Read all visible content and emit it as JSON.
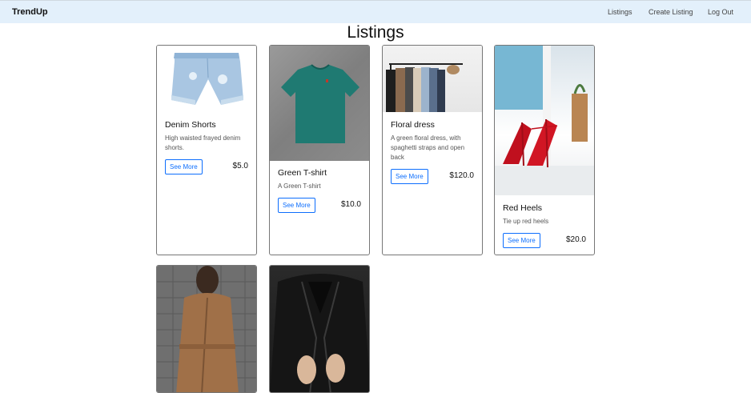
{
  "nav": {
    "brand": "TrendUp",
    "links": [
      "Listings",
      "Create Listing",
      "Log Out"
    ]
  },
  "page": {
    "title": "Listings"
  },
  "listings": [
    {
      "title": "Denim Shorts",
      "description": "High waisted frayed denim shorts.",
      "button": "See More",
      "price": "$5.0"
    },
    {
      "title": "Green T-shirt",
      "description": "A Green T-shirt",
      "button": "See More",
      "price": "$10.0"
    },
    {
      "title": "Floral dress",
      "description": "A green floral dress, with spaghetti straps and open back",
      "button": "See More",
      "price": "$120.0"
    },
    {
      "title": "Red Heels",
      "description": "Tie up red heels",
      "button": "See More",
      "price": "$20.0"
    },
    {
      "image": "brown-coat-photo"
    },
    {
      "image": "leather-jacket-photo"
    }
  ]
}
